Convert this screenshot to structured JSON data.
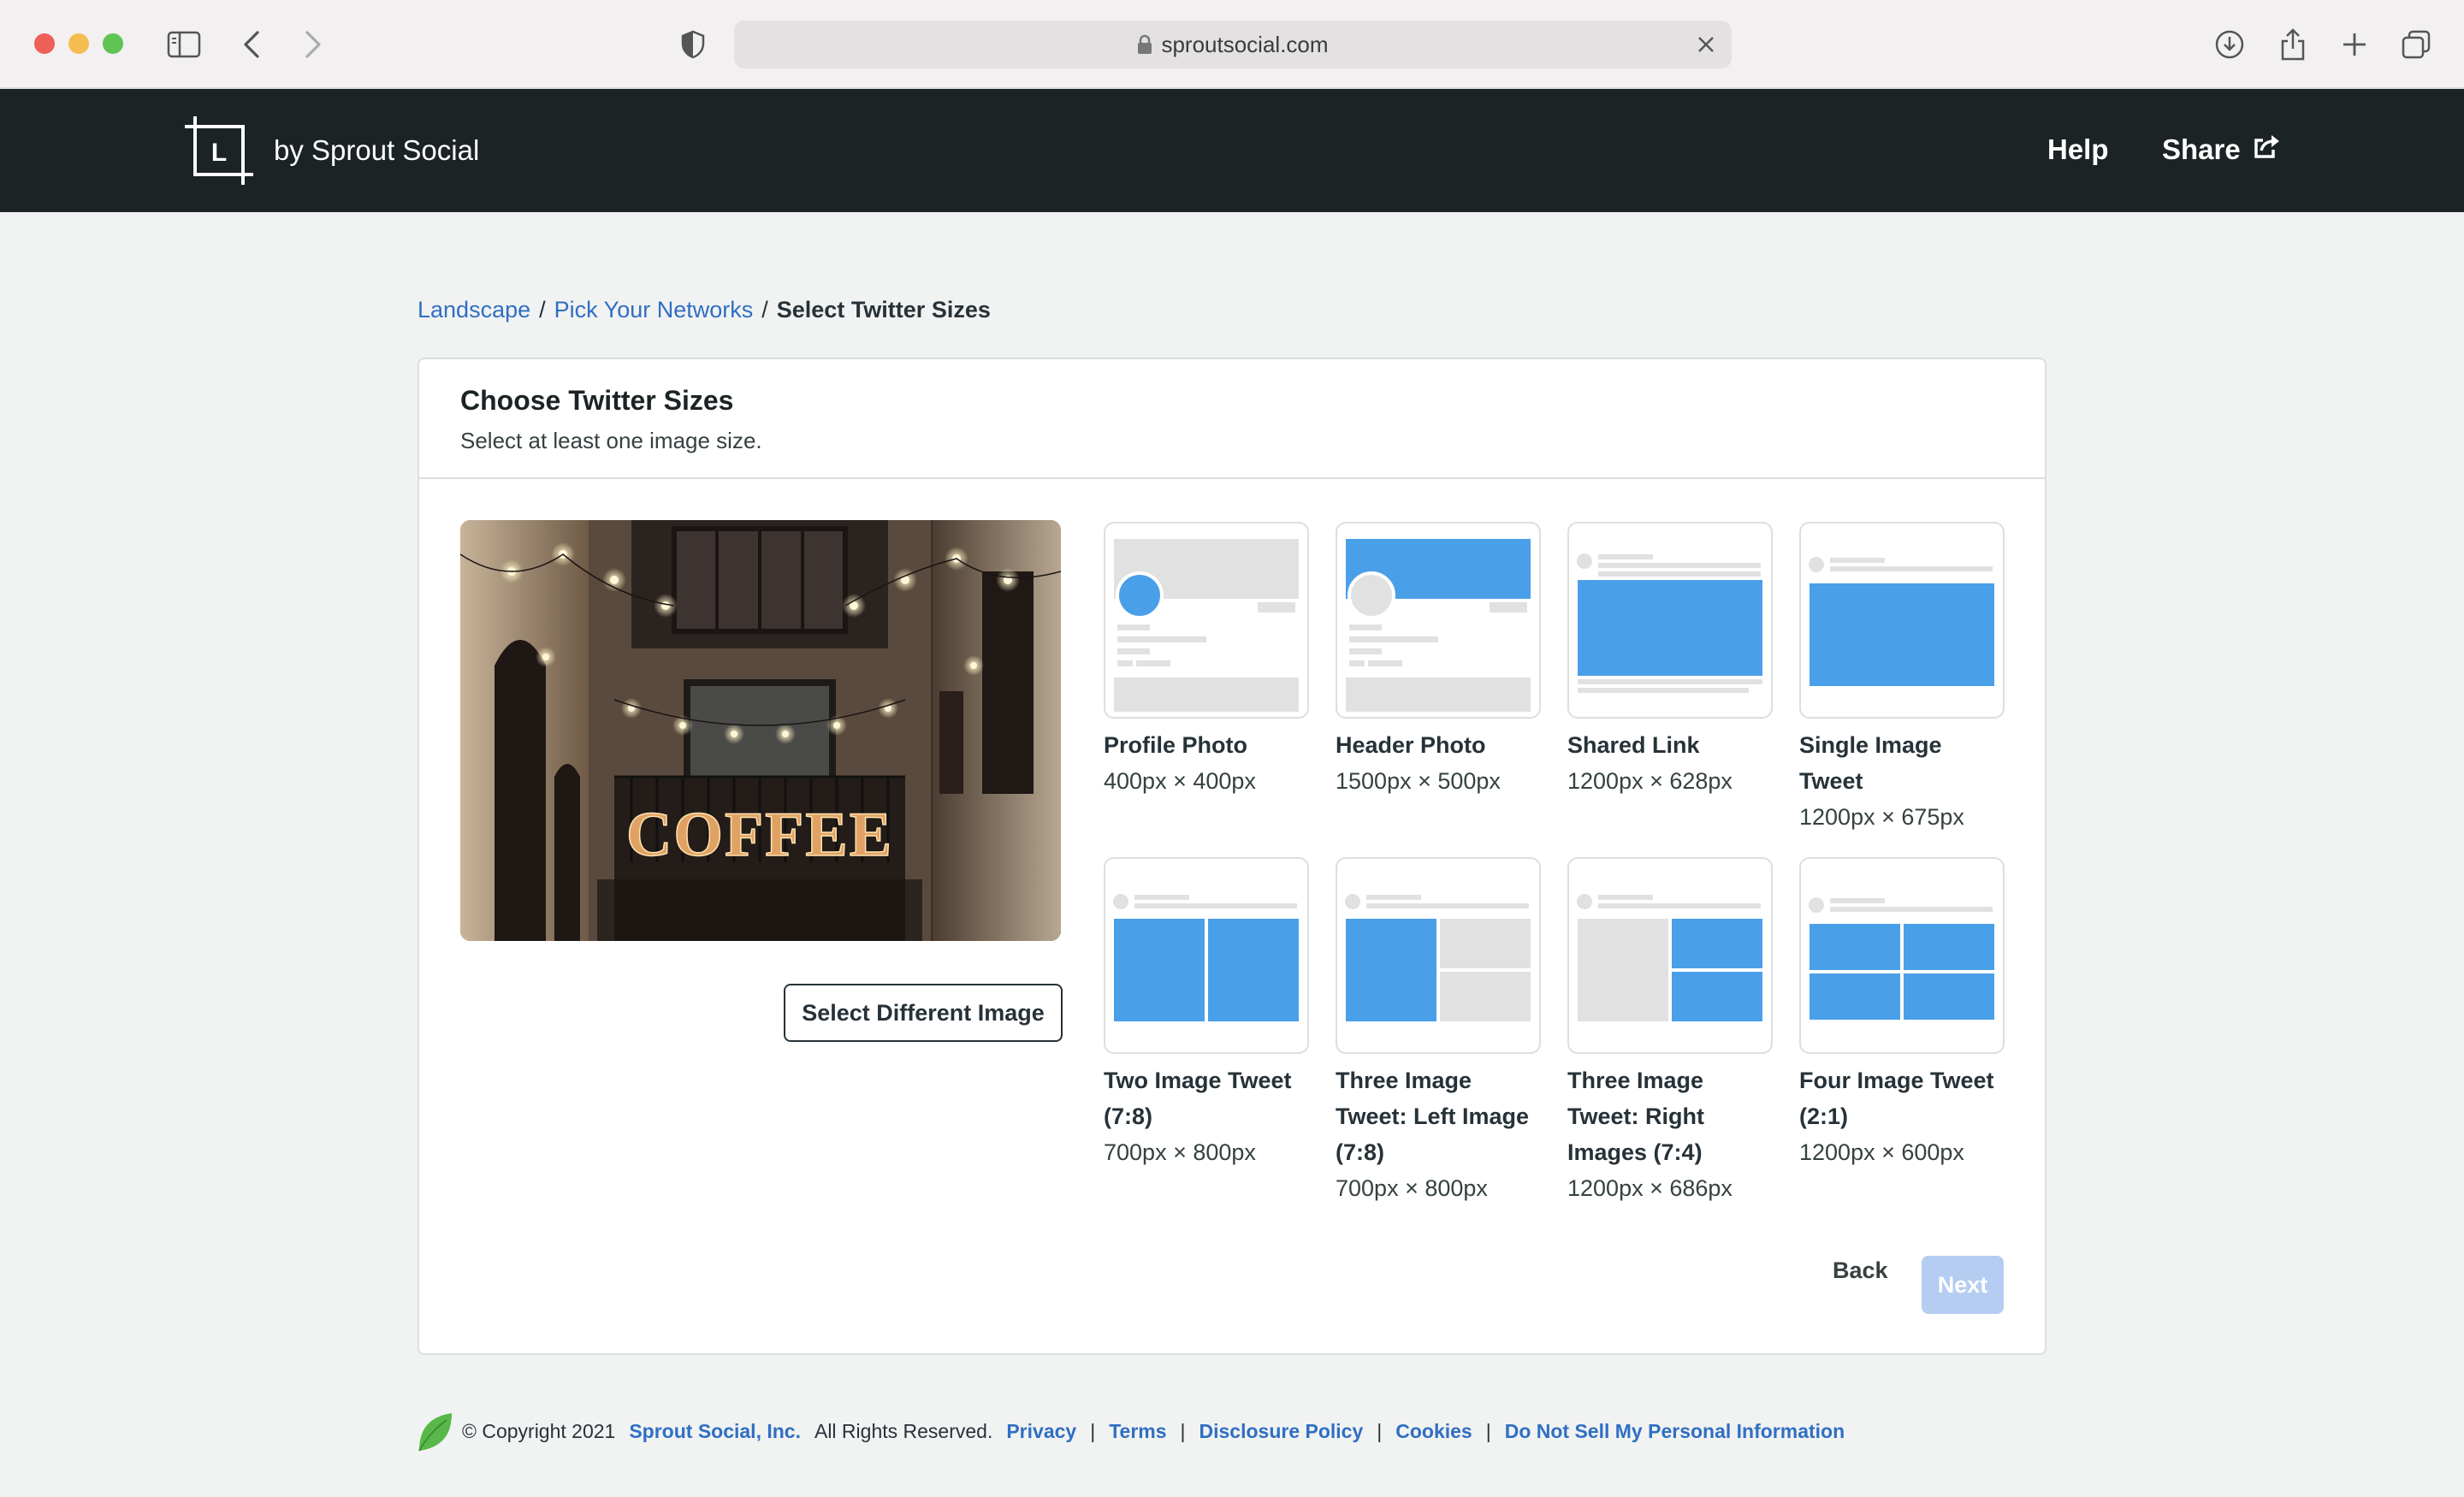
{
  "browser": {
    "url": "sproutsocial.com"
  },
  "header": {
    "brand": "by Sprout Social",
    "help": "Help",
    "share": "Share"
  },
  "breadcrumb": {
    "items": [
      "Landscape",
      "Pick Your Networks",
      "Select Twitter Sizes"
    ],
    "separator": "/"
  },
  "card": {
    "title": "Choose Twitter Sizes",
    "subtitle": "Select at least one image size.",
    "select_image_button": "Select Different Image",
    "preview_sign": "COFFEE",
    "options": [
      {
        "name": "Profile Photo",
        "size": "400px × 400px"
      },
      {
        "name": "Header Photo",
        "size": "1500px × 500px"
      },
      {
        "name": "Shared Link",
        "size": "1200px × 628px"
      },
      {
        "name": "Single Image Tweet",
        "size": "1200px × 675px"
      },
      {
        "name": "Two Image Tweet (7:8)",
        "size": "700px × 800px"
      },
      {
        "name": "Three Image Tweet: Left Image (7:8)",
        "size": "700px × 800px"
      },
      {
        "name": "Three Image Tweet: Right Images (7:4)",
        "size": "1200px × 686px"
      },
      {
        "name": "Four Image Tweet (2:1)",
        "size": "1200px × 600px"
      }
    ],
    "back": "Back",
    "next": "Next"
  },
  "footer": {
    "copyright": "© Copyright 2021",
    "company": "Sprout Social, Inc.",
    "rights": "All Rights Reserved.",
    "links": [
      "Privacy",
      "Terms",
      "Disclosure Policy",
      "Cookies",
      "Do Not Sell My Personal Information"
    ]
  },
  "colors": {
    "accent_blue": "#4a9fe9",
    "link_blue": "#2f6fc3",
    "header_bg": "#1c2325",
    "next_disabled": "#b4cdf0",
    "leaf_green": "#59b84a"
  }
}
